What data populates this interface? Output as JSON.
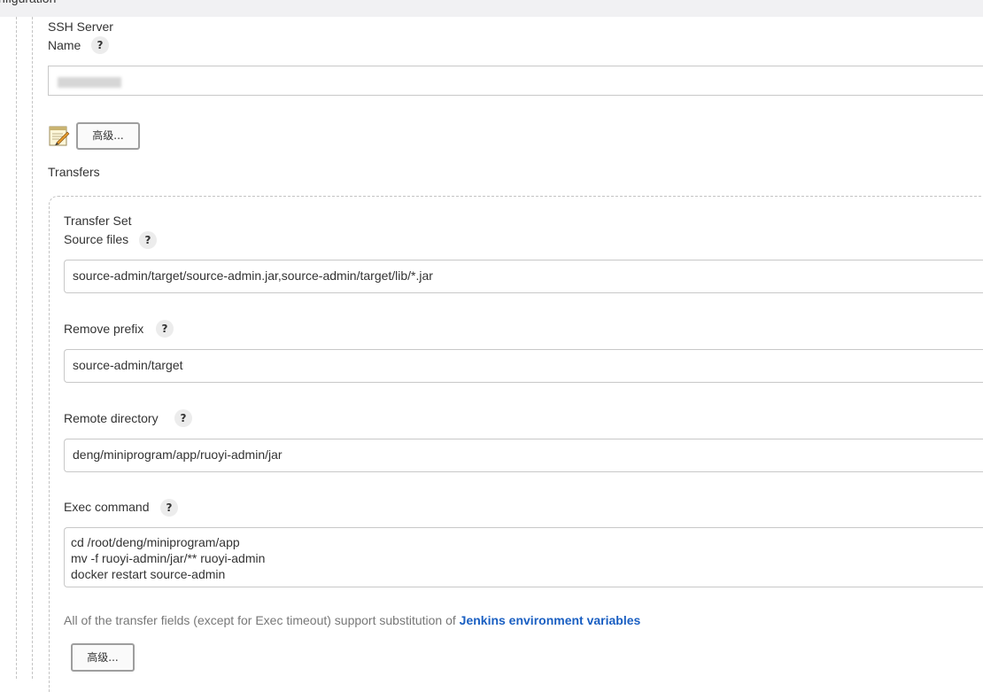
{
  "header": {
    "title": "nfiguration"
  },
  "ssh_server": {
    "section_label": "SSH Server",
    "name_label": "Name",
    "name_help": "?",
    "advanced_button": "高级..."
  },
  "transfers": {
    "label": "Transfers",
    "transfer_set": {
      "title": "Transfer Set",
      "source_files": {
        "label": "Source files",
        "help": "?",
        "value": "source-admin/target/source-admin.jar,source-admin/target/lib/*.jar"
      },
      "remove_prefix": {
        "label": "Remove prefix",
        "help": "?",
        "value": "source-admin/target"
      },
      "remote_directory": {
        "label": "Remote directory",
        "help": "?",
        "value": "deng/miniprogram/app/ruoyi-admin/jar"
      },
      "exec_command": {
        "label": "Exec command",
        "help": "?",
        "lines": [
          "cd /root/deng/miniprogram/app",
          "mv -f ruoyi-admin/jar/** ruoyi-admin",
          "docker restart  source-admin"
        ]
      },
      "hint_text": "All of the transfer fields (except for Exec timeout) support substitution of ",
      "hint_link": "Jenkins environment variables",
      "advanced_button": "高级..."
    }
  },
  "icons": {
    "edit": "notebook-pencil-icon",
    "help": "question-mark-icon"
  },
  "colors": {
    "link": "#1a5fc2",
    "hint_text": "#777777",
    "border": "#c8c8c8",
    "topbar": "#f1f1f3"
  }
}
